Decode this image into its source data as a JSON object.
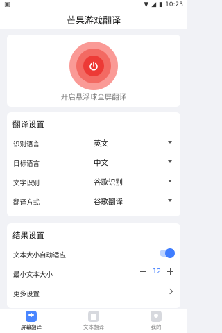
{
  "status_bar": {
    "left_icon": "app-notification-icon",
    "time": "10:23",
    "icons": [
      "wifi-icon",
      "signal-icon",
      "battery-icon"
    ]
  },
  "header": {
    "title": "芒果游戏翻译"
  },
  "power": {
    "label": "开启悬浮球全屏翻译",
    "color": "#ed3a36"
  },
  "translate_settings": {
    "title": "翻译设置",
    "rows": [
      {
        "label": "识别语言",
        "value": "英文"
      },
      {
        "label": "目标语言",
        "value": "中文"
      },
      {
        "label": "文字识别",
        "value": "谷歌识别"
      },
      {
        "label": "翻译方式",
        "value": "谷歌翻译"
      }
    ]
  },
  "result_settings": {
    "title": "结果设置",
    "auto_fit": {
      "label": "文本大小自动适应",
      "enabled": true
    },
    "min_size": {
      "label": "最小文本大小",
      "value": "12"
    },
    "more": {
      "label": "更多设置"
    }
  },
  "tabs": [
    {
      "label": "屏幕翻译",
      "icon": "gamepad-icon",
      "active": true
    },
    {
      "label": "文本翻译",
      "icon": "document-icon",
      "active": false
    },
    {
      "label": "我的",
      "icon": "user-icon",
      "active": false
    }
  ],
  "accent_color": "#3f7dff"
}
